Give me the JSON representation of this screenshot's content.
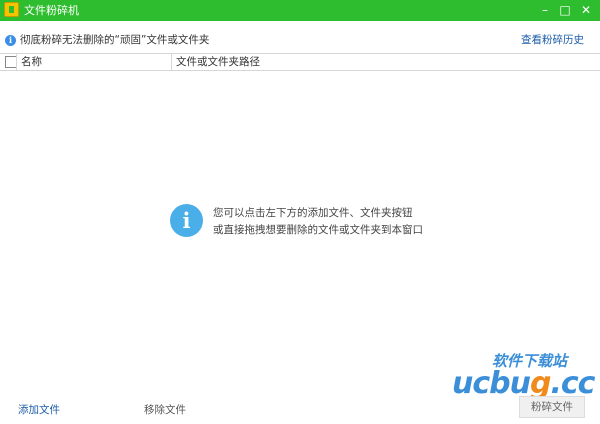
{
  "window": {
    "title": "文件粉碎机",
    "min_glyph": "–",
    "max_glyph": "□",
    "close_glyph": "✕"
  },
  "infobar": {
    "text": "彻底粉碎无法删除的“顽固”文件或文件夹",
    "history_link": "查看粉碎历史"
  },
  "table": {
    "columns": [
      "名称",
      "文件或文件夹路径"
    ]
  },
  "empty_hint": {
    "line1": "您可以点击左下方的添加文件、文件夹按钮",
    "line2": "或直接拖拽想要删除的文件或文件夹到本窗口"
  },
  "footer": {
    "add_file": "添加文件",
    "remove_file": "移除文件",
    "shred_button": "粉碎文件"
  },
  "watermark": {
    "top_text": "软件下载站",
    "ucbug_prefix": "ucbu",
    "ucbug_g": "g",
    "ucbug_suffix": ".cc"
  },
  "colors": {
    "title_bar": "#2ebd2e",
    "link_blue": "#1d5ca8",
    "info_icon": "#4aaee8"
  }
}
